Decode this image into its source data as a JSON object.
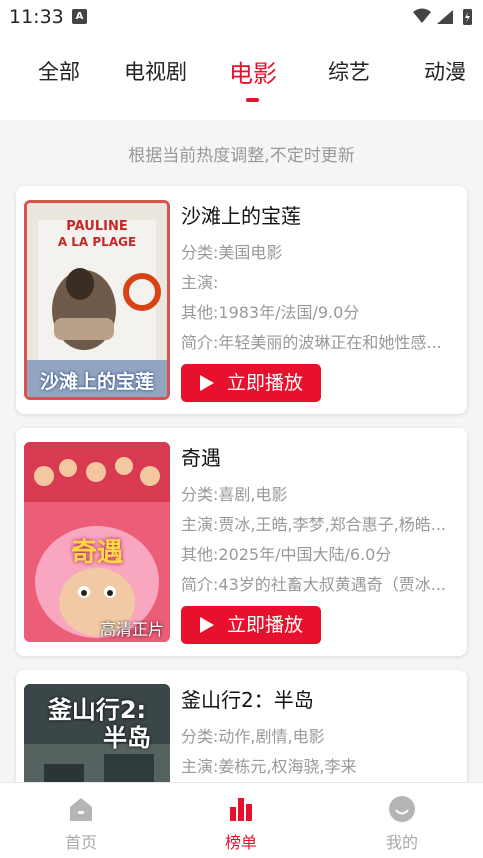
{
  "status_bar": {
    "time": "11:33",
    "notification_glyph": "A"
  },
  "tabs": [
    {
      "label": "全部"
    },
    {
      "label": "电视剧"
    },
    {
      "label": "电影",
      "active": true
    },
    {
      "label": "综艺"
    },
    {
      "label": "动漫"
    }
  ],
  "notice": "根据当前热度调整,不定时更新",
  "movies": [
    {
      "title": "沙滩上的宝莲",
      "category": "分类:美国电影",
      "cast": "主演:",
      "other": "其他:1983年/法国/9.0分",
      "synopsis": "简介:年轻美丽的波琳正在和她性感...",
      "play_label": "立即播放",
      "poster_title": "沙滩上的宝莲",
      "poster_top_text": "PAULINE",
      "poster_top_text2": "A LA PLAGE"
    },
    {
      "title": "奇遇",
      "category": "分类:喜剧,电影",
      "cast": "主演:贾冰,王皓,李梦,郑合惠子,杨皓...",
      "other": "其他:2025年/中国大陆/6.0分",
      "synopsis": "简介:43岁的社畜大叔黄遇奇（贾冰...",
      "play_label": "立即播放",
      "poster_title": "奇遇",
      "poster_badge": "高清正片"
    },
    {
      "title": "釜山行2：半岛",
      "category": "分类:动作,剧情,电影",
      "cast": "主演:姜栋元,权海骁,李来",
      "poster_title_line1": "釜山行2:",
      "poster_title_line2": "半岛"
    }
  ],
  "bottom_nav": [
    {
      "label": "首页",
      "icon": "home-icon"
    },
    {
      "label": "榜单",
      "icon": "chart-icon",
      "active": true
    },
    {
      "label": "我的",
      "icon": "profile-icon"
    }
  ],
  "colors": {
    "accent": "#e8112d",
    "muted": "#999999",
    "background": "#f5f5f5"
  }
}
